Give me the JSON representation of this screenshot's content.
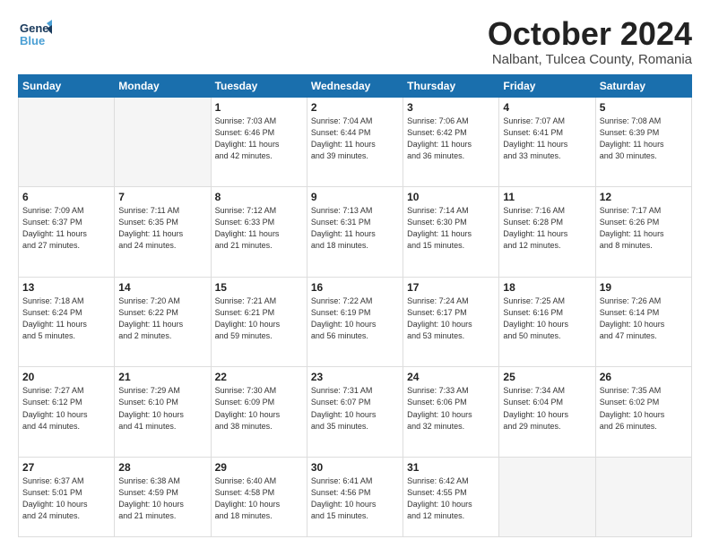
{
  "header": {
    "logo_line1": "General",
    "logo_line2": "Blue",
    "month": "October 2024",
    "location": "Nalbant, Tulcea County, Romania"
  },
  "weekdays": [
    "Sunday",
    "Monday",
    "Tuesday",
    "Wednesday",
    "Thursday",
    "Friday",
    "Saturday"
  ],
  "weeks": [
    [
      {
        "num": "",
        "info": ""
      },
      {
        "num": "",
        "info": ""
      },
      {
        "num": "1",
        "info": "Sunrise: 7:03 AM\nSunset: 6:46 PM\nDaylight: 11 hours\nand 42 minutes."
      },
      {
        "num": "2",
        "info": "Sunrise: 7:04 AM\nSunset: 6:44 PM\nDaylight: 11 hours\nand 39 minutes."
      },
      {
        "num": "3",
        "info": "Sunrise: 7:06 AM\nSunset: 6:42 PM\nDaylight: 11 hours\nand 36 minutes."
      },
      {
        "num": "4",
        "info": "Sunrise: 7:07 AM\nSunset: 6:41 PM\nDaylight: 11 hours\nand 33 minutes."
      },
      {
        "num": "5",
        "info": "Sunrise: 7:08 AM\nSunset: 6:39 PM\nDaylight: 11 hours\nand 30 minutes."
      }
    ],
    [
      {
        "num": "6",
        "info": "Sunrise: 7:09 AM\nSunset: 6:37 PM\nDaylight: 11 hours\nand 27 minutes."
      },
      {
        "num": "7",
        "info": "Sunrise: 7:11 AM\nSunset: 6:35 PM\nDaylight: 11 hours\nand 24 minutes."
      },
      {
        "num": "8",
        "info": "Sunrise: 7:12 AM\nSunset: 6:33 PM\nDaylight: 11 hours\nand 21 minutes."
      },
      {
        "num": "9",
        "info": "Sunrise: 7:13 AM\nSunset: 6:31 PM\nDaylight: 11 hours\nand 18 minutes."
      },
      {
        "num": "10",
        "info": "Sunrise: 7:14 AM\nSunset: 6:30 PM\nDaylight: 11 hours\nand 15 minutes."
      },
      {
        "num": "11",
        "info": "Sunrise: 7:16 AM\nSunset: 6:28 PM\nDaylight: 11 hours\nand 12 minutes."
      },
      {
        "num": "12",
        "info": "Sunrise: 7:17 AM\nSunset: 6:26 PM\nDaylight: 11 hours\nand 8 minutes."
      }
    ],
    [
      {
        "num": "13",
        "info": "Sunrise: 7:18 AM\nSunset: 6:24 PM\nDaylight: 11 hours\nand 5 minutes."
      },
      {
        "num": "14",
        "info": "Sunrise: 7:20 AM\nSunset: 6:22 PM\nDaylight: 11 hours\nand 2 minutes."
      },
      {
        "num": "15",
        "info": "Sunrise: 7:21 AM\nSunset: 6:21 PM\nDaylight: 10 hours\nand 59 minutes."
      },
      {
        "num": "16",
        "info": "Sunrise: 7:22 AM\nSunset: 6:19 PM\nDaylight: 10 hours\nand 56 minutes."
      },
      {
        "num": "17",
        "info": "Sunrise: 7:24 AM\nSunset: 6:17 PM\nDaylight: 10 hours\nand 53 minutes."
      },
      {
        "num": "18",
        "info": "Sunrise: 7:25 AM\nSunset: 6:16 PM\nDaylight: 10 hours\nand 50 minutes."
      },
      {
        "num": "19",
        "info": "Sunrise: 7:26 AM\nSunset: 6:14 PM\nDaylight: 10 hours\nand 47 minutes."
      }
    ],
    [
      {
        "num": "20",
        "info": "Sunrise: 7:27 AM\nSunset: 6:12 PM\nDaylight: 10 hours\nand 44 minutes."
      },
      {
        "num": "21",
        "info": "Sunrise: 7:29 AM\nSunset: 6:10 PM\nDaylight: 10 hours\nand 41 minutes."
      },
      {
        "num": "22",
        "info": "Sunrise: 7:30 AM\nSunset: 6:09 PM\nDaylight: 10 hours\nand 38 minutes."
      },
      {
        "num": "23",
        "info": "Sunrise: 7:31 AM\nSunset: 6:07 PM\nDaylight: 10 hours\nand 35 minutes."
      },
      {
        "num": "24",
        "info": "Sunrise: 7:33 AM\nSunset: 6:06 PM\nDaylight: 10 hours\nand 32 minutes."
      },
      {
        "num": "25",
        "info": "Sunrise: 7:34 AM\nSunset: 6:04 PM\nDaylight: 10 hours\nand 29 minutes."
      },
      {
        "num": "26",
        "info": "Sunrise: 7:35 AM\nSunset: 6:02 PM\nDaylight: 10 hours\nand 26 minutes."
      }
    ],
    [
      {
        "num": "27",
        "info": "Sunrise: 6:37 AM\nSunset: 5:01 PM\nDaylight: 10 hours\nand 24 minutes."
      },
      {
        "num": "28",
        "info": "Sunrise: 6:38 AM\nSunset: 4:59 PM\nDaylight: 10 hours\nand 21 minutes."
      },
      {
        "num": "29",
        "info": "Sunrise: 6:40 AM\nSunset: 4:58 PM\nDaylight: 10 hours\nand 18 minutes."
      },
      {
        "num": "30",
        "info": "Sunrise: 6:41 AM\nSunset: 4:56 PM\nDaylight: 10 hours\nand 15 minutes."
      },
      {
        "num": "31",
        "info": "Sunrise: 6:42 AM\nSunset: 4:55 PM\nDaylight: 10 hours\nand 12 minutes."
      },
      {
        "num": "",
        "info": ""
      },
      {
        "num": "",
        "info": ""
      }
    ]
  ]
}
